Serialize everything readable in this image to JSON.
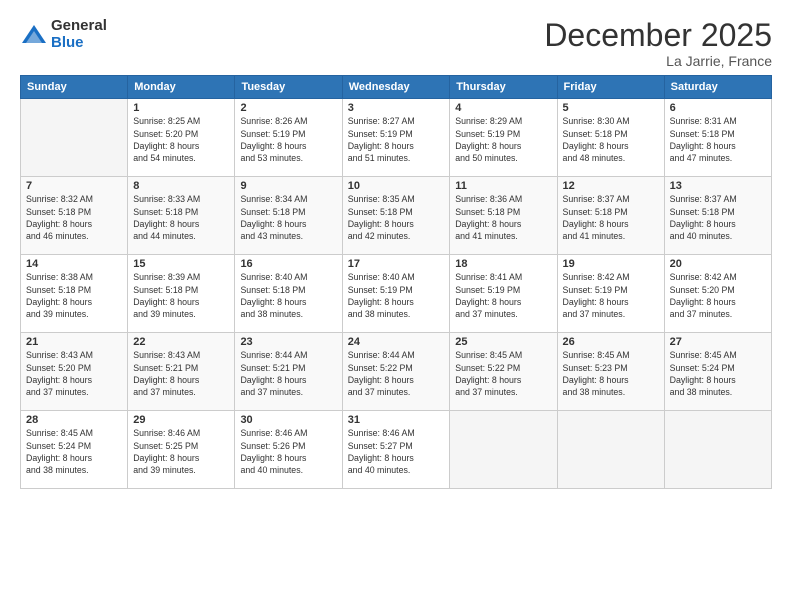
{
  "logo": {
    "general": "General",
    "blue": "Blue"
  },
  "title": "December 2025",
  "location": "La Jarrie, France",
  "headers": [
    "Sunday",
    "Monday",
    "Tuesday",
    "Wednesday",
    "Thursday",
    "Friday",
    "Saturday"
  ],
  "weeks": [
    [
      {
        "day": "",
        "info": ""
      },
      {
        "day": "1",
        "info": "Sunrise: 8:25 AM\nSunset: 5:20 PM\nDaylight: 8 hours\nand 54 minutes."
      },
      {
        "day": "2",
        "info": "Sunrise: 8:26 AM\nSunset: 5:19 PM\nDaylight: 8 hours\nand 53 minutes."
      },
      {
        "day": "3",
        "info": "Sunrise: 8:27 AM\nSunset: 5:19 PM\nDaylight: 8 hours\nand 51 minutes."
      },
      {
        "day": "4",
        "info": "Sunrise: 8:29 AM\nSunset: 5:19 PM\nDaylight: 8 hours\nand 50 minutes."
      },
      {
        "day": "5",
        "info": "Sunrise: 8:30 AM\nSunset: 5:18 PM\nDaylight: 8 hours\nand 48 minutes."
      },
      {
        "day": "6",
        "info": "Sunrise: 8:31 AM\nSunset: 5:18 PM\nDaylight: 8 hours\nand 47 minutes."
      }
    ],
    [
      {
        "day": "7",
        "info": "Sunrise: 8:32 AM\nSunset: 5:18 PM\nDaylight: 8 hours\nand 46 minutes."
      },
      {
        "day": "8",
        "info": "Sunrise: 8:33 AM\nSunset: 5:18 PM\nDaylight: 8 hours\nand 44 minutes."
      },
      {
        "day": "9",
        "info": "Sunrise: 8:34 AM\nSunset: 5:18 PM\nDaylight: 8 hours\nand 43 minutes."
      },
      {
        "day": "10",
        "info": "Sunrise: 8:35 AM\nSunset: 5:18 PM\nDaylight: 8 hours\nand 42 minutes."
      },
      {
        "day": "11",
        "info": "Sunrise: 8:36 AM\nSunset: 5:18 PM\nDaylight: 8 hours\nand 41 minutes."
      },
      {
        "day": "12",
        "info": "Sunrise: 8:37 AM\nSunset: 5:18 PM\nDaylight: 8 hours\nand 41 minutes."
      },
      {
        "day": "13",
        "info": "Sunrise: 8:37 AM\nSunset: 5:18 PM\nDaylight: 8 hours\nand 40 minutes."
      }
    ],
    [
      {
        "day": "14",
        "info": "Sunrise: 8:38 AM\nSunset: 5:18 PM\nDaylight: 8 hours\nand 39 minutes."
      },
      {
        "day": "15",
        "info": "Sunrise: 8:39 AM\nSunset: 5:18 PM\nDaylight: 8 hours\nand 39 minutes."
      },
      {
        "day": "16",
        "info": "Sunrise: 8:40 AM\nSunset: 5:18 PM\nDaylight: 8 hours\nand 38 minutes."
      },
      {
        "day": "17",
        "info": "Sunrise: 8:40 AM\nSunset: 5:19 PM\nDaylight: 8 hours\nand 38 minutes."
      },
      {
        "day": "18",
        "info": "Sunrise: 8:41 AM\nSunset: 5:19 PM\nDaylight: 8 hours\nand 37 minutes."
      },
      {
        "day": "19",
        "info": "Sunrise: 8:42 AM\nSunset: 5:19 PM\nDaylight: 8 hours\nand 37 minutes."
      },
      {
        "day": "20",
        "info": "Sunrise: 8:42 AM\nSunset: 5:20 PM\nDaylight: 8 hours\nand 37 minutes."
      }
    ],
    [
      {
        "day": "21",
        "info": "Sunrise: 8:43 AM\nSunset: 5:20 PM\nDaylight: 8 hours\nand 37 minutes."
      },
      {
        "day": "22",
        "info": "Sunrise: 8:43 AM\nSunset: 5:21 PM\nDaylight: 8 hours\nand 37 minutes."
      },
      {
        "day": "23",
        "info": "Sunrise: 8:44 AM\nSunset: 5:21 PM\nDaylight: 8 hours\nand 37 minutes."
      },
      {
        "day": "24",
        "info": "Sunrise: 8:44 AM\nSunset: 5:22 PM\nDaylight: 8 hours\nand 37 minutes."
      },
      {
        "day": "25",
        "info": "Sunrise: 8:45 AM\nSunset: 5:22 PM\nDaylight: 8 hours\nand 37 minutes."
      },
      {
        "day": "26",
        "info": "Sunrise: 8:45 AM\nSunset: 5:23 PM\nDaylight: 8 hours\nand 38 minutes."
      },
      {
        "day": "27",
        "info": "Sunrise: 8:45 AM\nSunset: 5:24 PM\nDaylight: 8 hours\nand 38 minutes."
      }
    ],
    [
      {
        "day": "28",
        "info": "Sunrise: 8:45 AM\nSunset: 5:24 PM\nDaylight: 8 hours\nand 38 minutes."
      },
      {
        "day": "29",
        "info": "Sunrise: 8:46 AM\nSunset: 5:25 PM\nDaylight: 8 hours\nand 39 minutes."
      },
      {
        "day": "30",
        "info": "Sunrise: 8:46 AM\nSunset: 5:26 PM\nDaylight: 8 hours\nand 40 minutes."
      },
      {
        "day": "31",
        "info": "Sunrise: 8:46 AM\nSunset: 5:27 PM\nDaylight: 8 hours\nand 40 minutes."
      },
      {
        "day": "",
        "info": ""
      },
      {
        "day": "",
        "info": ""
      },
      {
        "day": "",
        "info": ""
      }
    ]
  ]
}
